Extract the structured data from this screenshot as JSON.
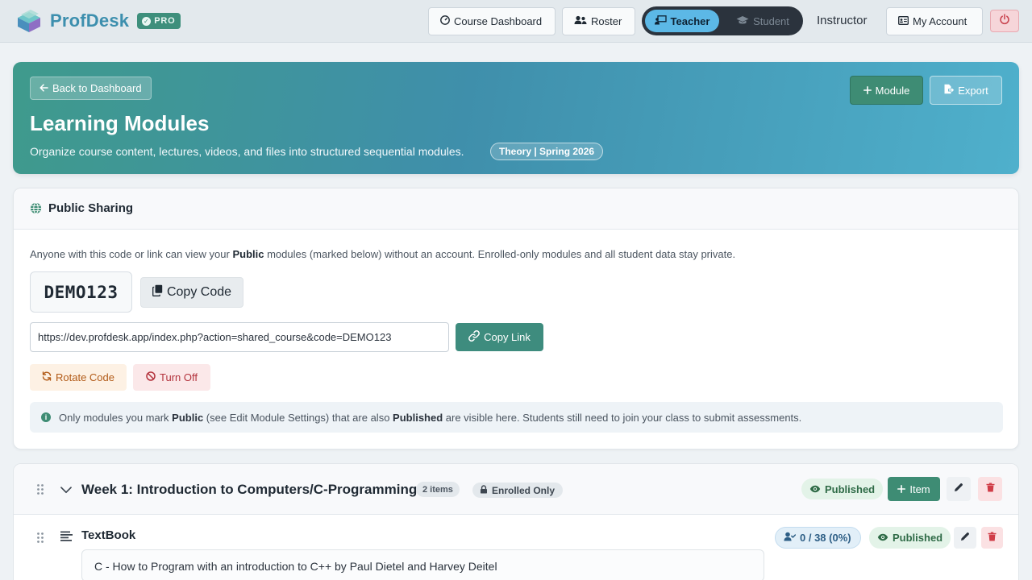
{
  "app": {
    "name": "ProfDesk",
    "plan_badge": "PRO"
  },
  "nav": {
    "course_dashboard": "Course Dashboard",
    "roster": "Roster",
    "role_teacher": "Teacher",
    "role_student": "Student",
    "active_role": "Teacher",
    "user_role_label": "Instructor",
    "my_account": "My Account"
  },
  "hero": {
    "back_label": "Back to Dashboard",
    "title": "Learning Modules",
    "subtitle": "Organize course content, lectures, videos, and files into structured sequential modules.",
    "term_badge": "Theory | Spring 2026",
    "add_module_label": "Module",
    "export_label": "Export"
  },
  "sharing": {
    "title": "Public Sharing",
    "desc_pre": "Anyone with this code or link can view your ",
    "desc_bold": "Public",
    "desc_post": " modules (marked below) without an account. Enrolled-only modules and all student data stay private.",
    "code": "DEMO123",
    "copy_code_label": "Copy Code",
    "share_link": "https://dev.profdesk.app/index.php?action=shared_course&code=DEMO123",
    "copy_link_label": "Copy Link",
    "rotate_label": "Rotate Code",
    "turn_off_label": "Turn Off",
    "info_pre": "Only modules you mark ",
    "info_bold1": "Public",
    "info_mid": " (see Edit Module Settings) that are also ",
    "info_bold2": "Published",
    "info_post": " are visible here. Students still need to join your class to submit assessments."
  },
  "module": {
    "title": "Week 1: Introduction to Computers/C-Programming",
    "items_count": "2 items",
    "visibility": "Enrolled Only",
    "status": "Published",
    "add_item_label": "Item",
    "items": [
      {
        "title": "TextBook",
        "description": "C - How to Program with an introduction to C++ by Paul Dietel and Harvey Deitel",
        "progress": "0 / 38 (0%)",
        "status": "Published"
      }
    ]
  },
  "colors": {
    "brand": "#3d8fae",
    "accent_green": "#3e8c74",
    "danger": "#b3323c"
  }
}
